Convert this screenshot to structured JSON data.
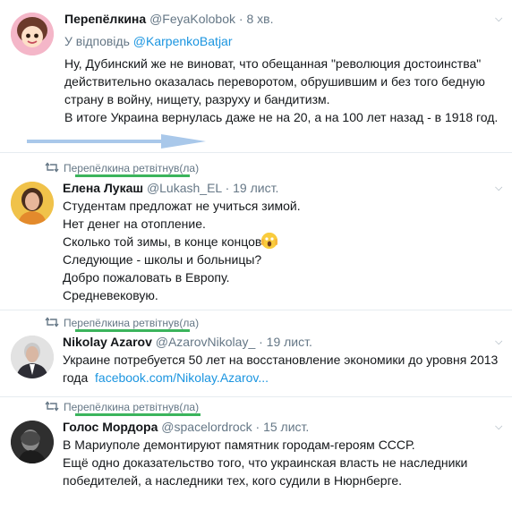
{
  "tweets": [
    {
      "name": "Перепёлкина",
      "handle": "@FeyaKolobok",
      "time": "· 8 хв.",
      "reply_prefix": "У відповідь",
      "reply_handle": "@KarpenkoBatjar",
      "lines": [
        "Ну, Дубинский же не виноват, что обещанная \"революция достоинства\"",
        "действительно оказалась переворотом, обрушившим и без того бедную",
        "страну в войну, нищету, разруху и бандитизм.",
        "В итоге Украина вернулась даже не на 20, а на 100 лет назад - в 1918 год."
      ]
    },
    {
      "retweet_label": "Перепёлкина ретвітнув(ла)",
      "name": "Елена Лукаш",
      "handle": "@Lukash_EL",
      "time": "· 19 лист.",
      "lines": [
        "Студентам предложат не учиться зимой.",
        "Нет денег на отопление.",
        "Сколько той зимы, в конце концов",
        "Следующие - школы и больницы?",
        "Добро пожаловать в Европу.",
        "Средневековую."
      ]
    },
    {
      "retweet_label": "Перепёлкина ретвітнув(ла)",
      "name": "Nikolay Azarov",
      "handle": "@AzarovNikolay_",
      "time": "· 19 лист.",
      "lines": [
        "Украине потребуется 50 лет на восстановление экономики до уровня 2013"
      ],
      "line2_prefix": "года",
      "link": "facebook.com/Nikolay.Azarov..."
    },
    {
      "retweet_label": "Перепёлкина ретвітнув(ла)",
      "name": "Голос Мордора",
      "handle": "@spacelordrock",
      "time": "· 15 лист.",
      "lines": [
        "В Мариуполе демонтируют памятник городам-героям СССР.",
        "Ещё одно доказательство того, что украинская власть не наследники",
        "победителей, а наследники тех, кого судили в Нюрнберге."
      ]
    }
  ],
  "colors": {
    "link": "#1b95e0",
    "annotation_arrow": "#a9c8ea",
    "annotation_underline": "#3bb45c"
  }
}
